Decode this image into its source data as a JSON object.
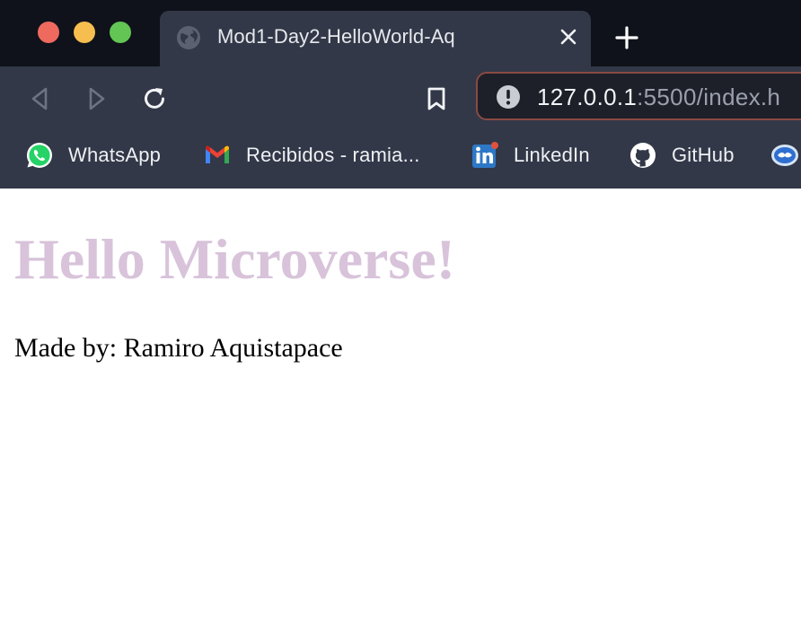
{
  "browser": {
    "tab": {
      "title": "Mod1-Day2-HelloWorld-Aq",
      "icon": "globe-icon"
    },
    "address_bar": {
      "host": "127.0.0.1",
      "rest": ":5500/index.h"
    },
    "bookmarks": [
      {
        "label": "WhatsApp",
        "icon": "whatsapp-icon"
      },
      {
        "label": "Recibidos - ramia...",
        "icon": "gmail-icon"
      },
      {
        "label": "LinkedIn",
        "icon": "linkedin-icon"
      },
      {
        "label": "GitHub",
        "icon": "github-icon"
      },
      {
        "label": "",
        "icon": "bank-icon"
      }
    ],
    "colors": {
      "frame": "#0f121a",
      "toolbar": "#323848",
      "address_border": "#8a4a44"
    }
  },
  "page": {
    "heading": "Hello Microverse!",
    "credit": "Made by: Ramiro Aquistapace",
    "heading_color": "#d8c3da"
  }
}
